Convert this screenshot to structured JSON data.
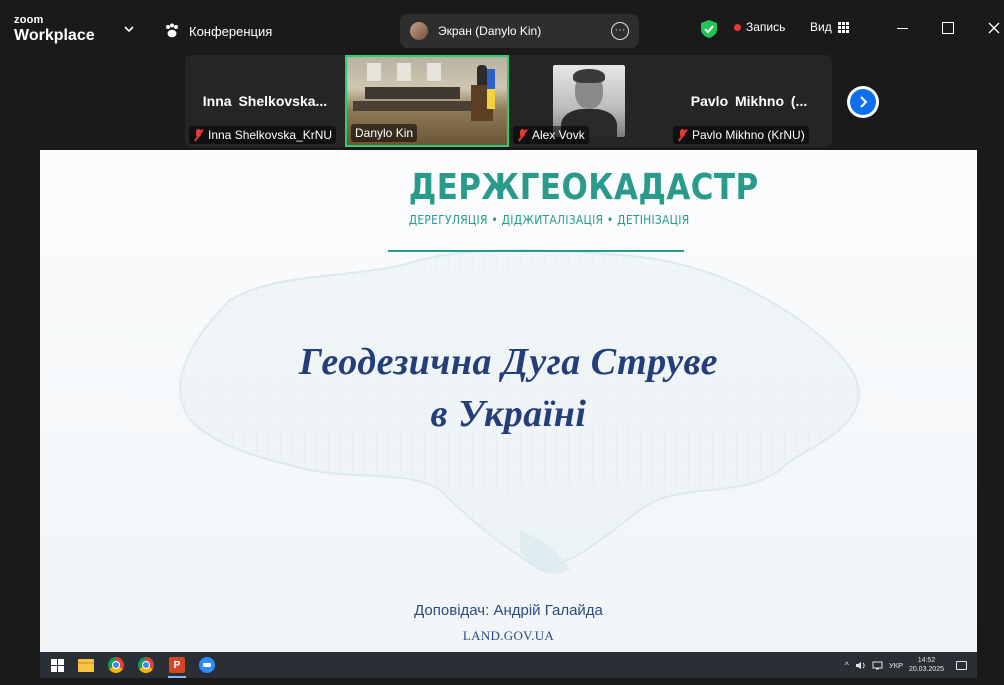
{
  "app": {
    "brand_line1": "zoom",
    "brand_line2": "Workplace",
    "meeting_label": "Конференция",
    "screen_share_label": "Экран (Danylo Kin)",
    "record_label": "Запись",
    "view_label": "Вид"
  },
  "participants": [
    {
      "display_name": "Inna  Shelkovska...",
      "label": "Inna Shelkovska_KrNU",
      "muted": true,
      "video": false
    },
    {
      "display_name": "",
      "label": "Danylo Kin",
      "muted": false,
      "video": true,
      "active_speaker": true
    },
    {
      "display_name": "",
      "label": "Alex Vovk",
      "muted": true,
      "video": false,
      "photo": true
    },
    {
      "display_name": "Pavlo  Mikhno  (...",
      "label": "Pavlo Mikhno (KrNU)",
      "muted": true,
      "video": false
    }
  ],
  "slide": {
    "logo_title": "ДЕРЖГЕОКАДАСТР",
    "logo_subtitle": "ДЕРЕГУЛЯЦІЯ • ДІДЖИТАЛІЗАЦІЯ • ДЕТІНІЗАЦІЯ",
    "title_line1": "Геодезична Дуга Струве",
    "title_line2": "в Україні",
    "presenter": "Доповідач: Андрій Галайда",
    "website": "LAND.GOV.UA"
  },
  "taskbar": {
    "language": "УКР",
    "time": "14:52",
    "date": "20.03.2025"
  },
  "colors": {
    "accent_green": "#2ecc71",
    "zoom_blue": "#0e71eb",
    "logo_teal": "#2a9a8d",
    "slide_title_blue": "#243e7a",
    "record_red": "#e53935"
  }
}
